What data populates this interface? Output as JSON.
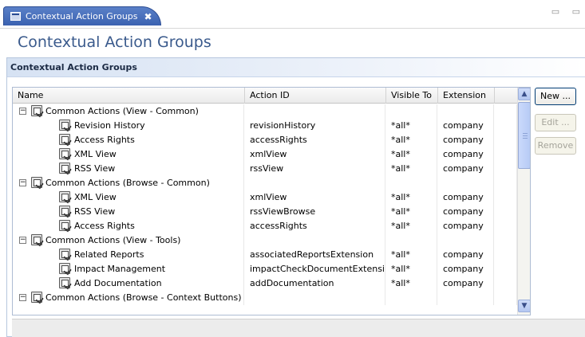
{
  "tab": {
    "title": "Contextual Action Groups",
    "close_glyph": "✖",
    "window_controls": "▭ ▭"
  },
  "page": {
    "title": "Contextual Action Groups"
  },
  "section": {
    "title": "Contextual Action Groups"
  },
  "table": {
    "columns": [
      "Name",
      "Action ID",
      "Visible To",
      "Extension"
    ],
    "rows": [
      {
        "type": "group",
        "name": "Common Actions (View - Common)",
        "action_id": "",
        "visible_to": "",
        "extension": ""
      },
      {
        "type": "item",
        "name": "Revision History",
        "action_id": "revisionHistory",
        "visible_to": "*all*",
        "extension": "company"
      },
      {
        "type": "item",
        "name": "Access Rights",
        "action_id": "accessRights",
        "visible_to": "*all*",
        "extension": "company"
      },
      {
        "type": "item",
        "name": "XML View",
        "action_id": "xmlView",
        "visible_to": "*all*",
        "extension": "company"
      },
      {
        "type": "item",
        "name": "RSS View",
        "action_id": "rssView",
        "visible_to": "*all*",
        "extension": "company"
      },
      {
        "type": "group",
        "name": "Common Actions (Browse - Common)",
        "action_id": "",
        "visible_to": "",
        "extension": ""
      },
      {
        "type": "item",
        "name": "XML View",
        "action_id": "xmlView",
        "visible_to": "*all*",
        "extension": "company"
      },
      {
        "type": "item",
        "name": "RSS View",
        "action_id": "rssViewBrowse",
        "visible_to": "*all*",
        "extension": "company"
      },
      {
        "type": "item",
        "name": "Access Rights",
        "action_id": "accessRights",
        "visible_to": "*all*",
        "extension": "company"
      },
      {
        "type": "group",
        "name": "Common Actions (View - Tools)",
        "action_id": "",
        "visible_to": "",
        "extension": ""
      },
      {
        "type": "item",
        "name": "Related Reports",
        "action_id": "associatedReportsExtension",
        "visible_to": "*all*",
        "extension": "company"
      },
      {
        "type": "item",
        "name": "Impact Management",
        "action_id": "impactCheckDocumentExtension",
        "visible_to": "*all*",
        "extension": "company"
      },
      {
        "type": "item",
        "name": "Add Documentation",
        "action_id": "addDocumentation",
        "visible_to": "*all*",
        "extension": "company"
      },
      {
        "type": "group",
        "name": "Common Actions (Browse - Context Buttons)",
        "action_id": "",
        "visible_to": "",
        "extension": ""
      }
    ],
    "expander_glyph": "−"
  },
  "scrollbar": {
    "up_glyph": "▲",
    "down_glyph": "▼"
  },
  "buttons": {
    "new": "New ...",
    "edit": "Edit ...",
    "remove": "Remove"
  }
}
